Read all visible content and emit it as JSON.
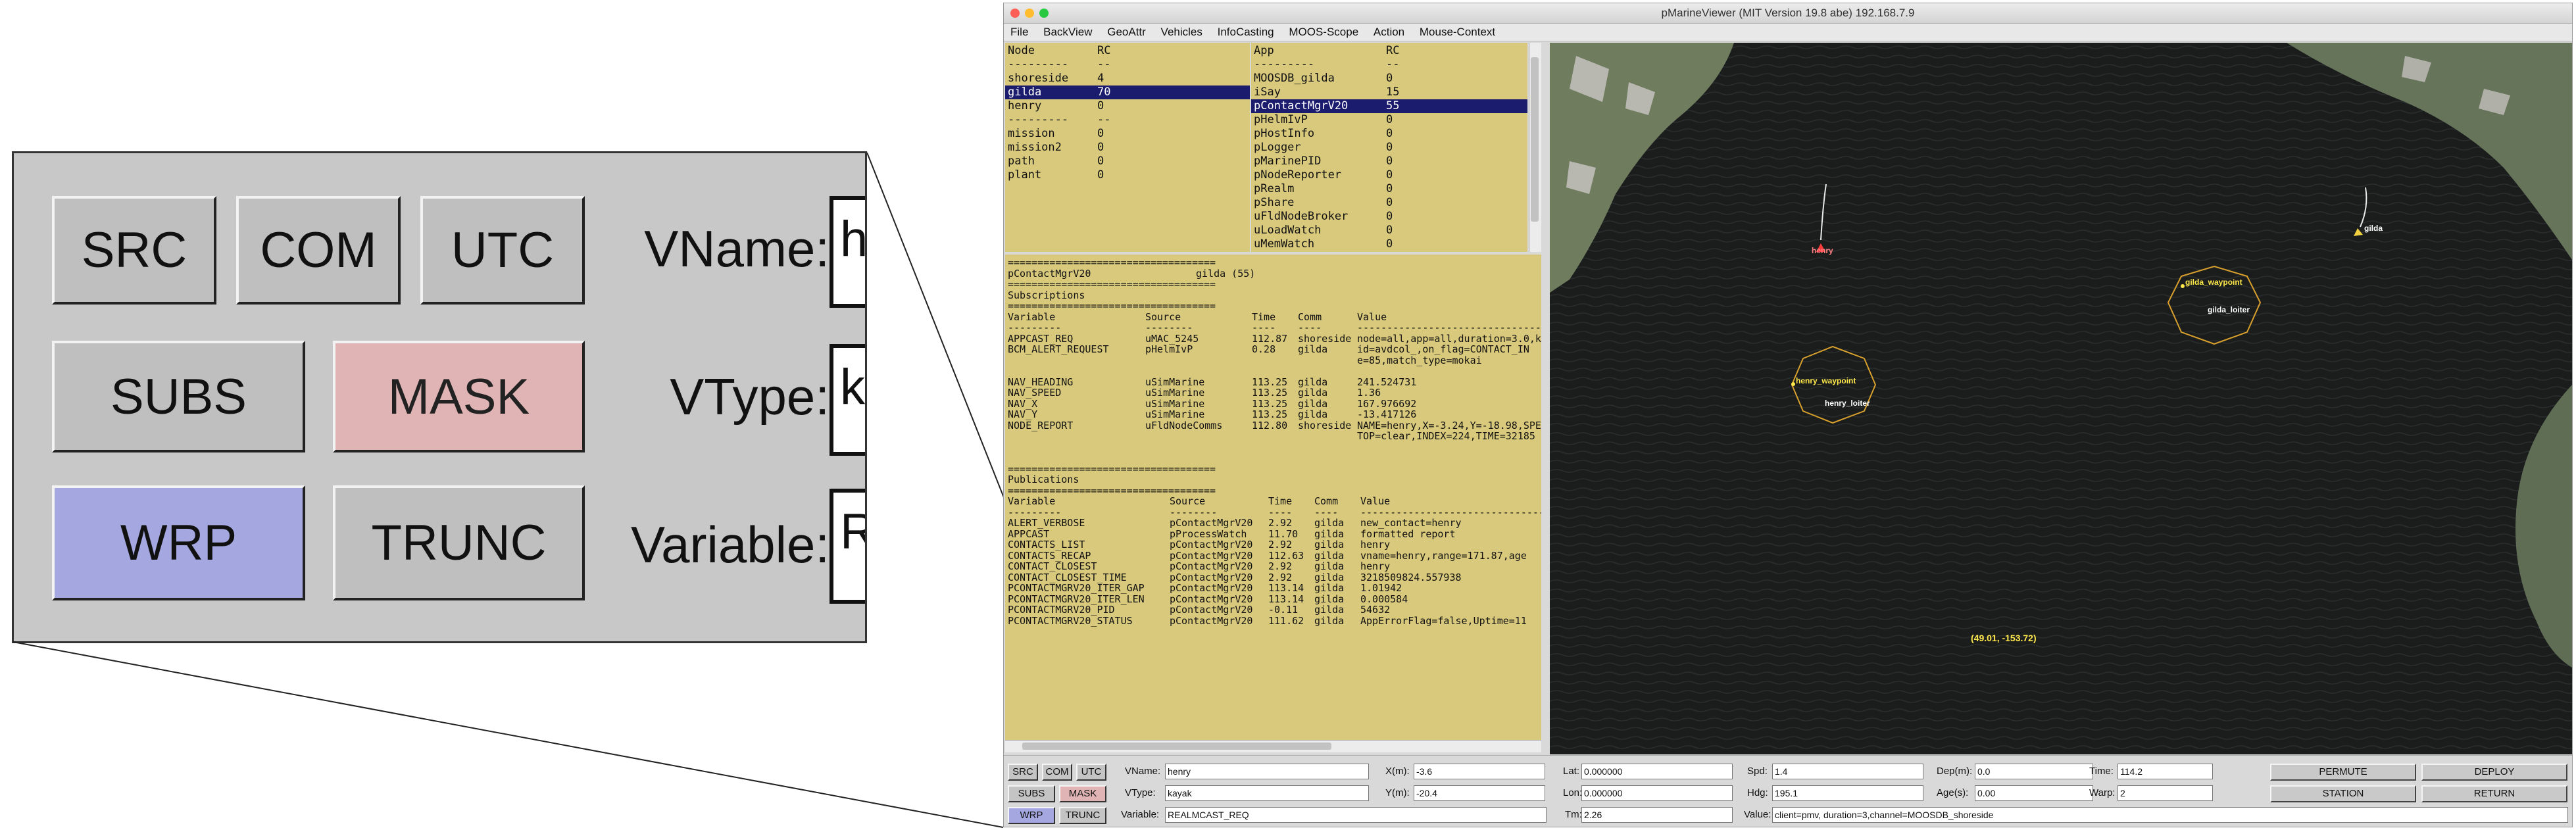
{
  "window": {
    "title": "pMarineViewer (MIT Version 19.8 abe) 192.168.7.9"
  },
  "menu": [
    "File",
    "BackView",
    "GeoAttr",
    "Vehicles",
    "InfoCasting",
    "MOOS-Scope",
    "Action",
    "Mouse-Context"
  ],
  "node_pane": {
    "headers": [
      "Node",
      "RC"
    ],
    "rows": [
      {
        "a": "---------",
        "b": "--"
      },
      {
        "a": "shoreside",
        "b": "4"
      },
      {
        "a": "gilda",
        "b": "70",
        "selected": true
      },
      {
        "a": "henry",
        "b": "0"
      },
      {
        "a": "---------",
        "b": "--"
      },
      {
        "a": "mission",
        "b": "0"
      },
      {
        "a": "mission2",
        "b": "0"
      },
      {
        "a": "path",
        "b": "0"
      },
      {
        "a": "plant",
        "b": "0"
      }
    ]
  },
  "app_pane": {
    "headers": [
      "App",
      "RC"
    ],
    "rows": [
      {
        "a": "---------",
        "b": "--"
      },
      {
        "a": "MOOSDB_gilda",
        "b": "0"
      },
      {
        "a": "iSay",
        "b": "15"
      },
      {
        "a": "pContactMgrV20",
        "b": "55",
        "selected": true
      },
      {
        "a": "pHelmIvP",
        "b": "0"
      },
      {
        "a": "pHostInfo",
        "b": "0"
      },
      {
        "a": "pLogger",
        "b": "0"
      },
      {
        "a": "pMarinePID",
        "b": "0"
      },
      {
        "a": "pNodeReporter",
        "b": "0"
      },
      {
        "a": "pRealm",
        "b": "0"
      },
      {
        "a": "pShare",
        "b": "0"
      },
      {
        "a": "uFldNodeBroker",
        "b": "0"
      },
      {
        "a": "uLoadWatch",
        "b": "0"
      },
      {
        "a": "uMemWatch",
        "b": "0"
      }
    ]
  },
  "info_pane": {
    "rule": "===================================",
    "title": "pContactMgrV20",
    "title_right": "gilda (55)",
    "subs_label": "Subscriptions",
    "subs_headers": [
      "Variable",
      "Source",
      "Time",
      "Comm",
      "Value"
    ],
    "subs_dashes": [
      "---------",
      "--------",
      "----",
      "----",
      "--------------------------------------"
    ],
    "subs": [
      [
        "APPCAST_REQ",
        "uMAC_5245",
        "112.87",
        "shoreside",
        "node=all,app=all,duration=3.0,k"
      ],
      [
        "BCM_ALERT_REQUEST",
        "pHelmIvP",
        "0.28",
        "gilda",
        "id=avdcol_,on_flag=CONTACT_IN"
      ],
      [
        "",
        "",
        "",
        "",
        "e=85,match_type=mokai"
      ],
      [
        "NAV_HEADING",
        "uSimMarine",
        "113.25",
        "gilda",
        "241.524731"
      ],
      [
        "NAV_SPEED",
        "uSimMarine",
        "113.25",
        "gilda",
        "1.36"
      ],
      [
        "NAV_X",
        "uSimMarine",
        "113.25",
        "gilda",
        "167.976692"
      ],
      [
        "NAV_Y",
        "uSimMarine",
        "113.25",
        "gilda",
        "-13.417126"
      ],
      [
        "NODE_REPORT",
        "uFldNodeComms",
        "112.80",
        "shoreside",
        "NAME=henry,X=-3.24,Y=-18.98,SPE"
      ],
      [
        "",
        "",
        "",
        "",
        "TOP=clear,INDEX=224,TIME=32185"
      ]
    ],
    "pubs_label": "Publications",
    "pubs_headers": [
      "Variable",
      "Source",
      "Time",
      "Comm",
      "Value"
    ],
    "pubs_dashes": [
      "---------",
      "--------",
      "----",
      "----",
      "--------------------------------------"
    ],
    "pubs": [
      [
        "ALERT_VERBOSE",
        "pContactMgrV20",
        "2.92",
        "gilda",
        "new_contact=henry"
      ],
      [
        "APPCAST",
        "pProcessWatch",
        "11.70",
        "gilda",
        "formatted report"
      ],
      [
        "CONTACTS_LIST",
        "pContactMgrV20",
        "2.92",
        "gilda",
        "henry"
      ],
      [
        "CONTACTS_RECAP",
        "pContactMgrV20",
        "112.63",
        "gilda",
        "vname=henry,range=171.87,age"
      ],
      [
        "CONTACT_CLOSEST",
        "pContactMgrV20",
        "2.92",
        "gilda",
        "henry"
      ],
      [
        "CONTACT_CLOSEST_TIME",
        "pContactMgrV20",
        "2.92",
        "gilda",
        "3218509824.557938"
      ],
      [
        "PCONTACTMGRV20_ITER_GAP",
        "pContactMgrV20",
        "113.14",
        "gilda",
        "1.01942"
      ],
      [
        "PCONTACTMGRV20_ITER_LEN",
        "pContactMgrV20",
        "113.14",
        "gilda",
        "0.000584"
      ],
      [
        "PCONTACTMGRV20_PID",
        "pContactMgrV20",
        "-0.11",
        "gilda",
        "54632"
      ],
      [
        "PCONTACTMGRV20_STATUS",
        "pContactMgrV20",
        "111.62",
        "gilda",
        "AppErrorFlag=false,Uptime=11"
      ]
    ]
  },
  "map": {
    "labels": {
      "henry": "henry",
      "gilda": "gilda",
      "gilda_waypoint": "gilda_waypoint",
      "gilda_loiter": "gilda_loiter",
      "henry_waypoint": "henry_waypoint",
      "henry_loiter": "henry_loiter",
      "coords": "(49.01, -153.72)"
    },
    "colors": {
      "water": "#1b1d1d",
      "land": "#6c7a5c",
      "polygon": "#d8a02c",
      "vehicle": "#ff3b3b",
      "coord_text": "#ffe94a"
    }
  },
  "buttons": {
    "src": "SRC",
    "com": "COM",
    "utc": "UTC",
    "subs": "SUBS",
    "mask": "MASK",
    "wrp": "WRP",
    "trunc": "TRUNC",
    "permute": "PERMUTE",
    "deploy": "DEPLOY",
    "station": "STATION",
    "return": "RETURN",
    "mask_color": "#e0b4b4",
    "wrp_color": "#a5a8e0"
  },
  "fields": {
    "vname_label": "VName:",
    "vname": "henry",
    "vtype_label": "VType:",
    "vtype": "kayak",
    "variable_label": "Variable:",
    "variable": "REALMCAST_REQ",
    "xm_label": "X(m):",
    "xm": "-3.6",
    "ym_label": "Y(m):",
    "ym": "-20.4",
    "lat_label": "Lat:",
    "lat": "0.000000",
    "lon_label": "Lon:",
    "lon": "0.000000",
    "spd_label": "Spd:",
    "spd": "1.4",
    "hdg_label": "Hdg:",
    "hdg": "195.1",
    "dep_label": "Dep(m):",
    "dep": "0.0",
    "age_label": "Age(s):",
    "age": "0.00",
    "time_label": "Time:",
    "time": "114.2",
    "warp_label": "Warp:",
    "warp": "2",
    "tm_label": "Tm:",
    "tm": "2.26",
    "value_label": "Value:",
    "value": "client=pmv, duration=3,channel=MOOSDB_shoreside"
  },
  "zoom": {
    "vname_label": "VName:",
    "vtype_label": "VType:",
    "variable_label": "Variable:",
    "vname_partial": "h",
    "vtype_partial": "k",
    "variable_partial": "R"
  }
}
